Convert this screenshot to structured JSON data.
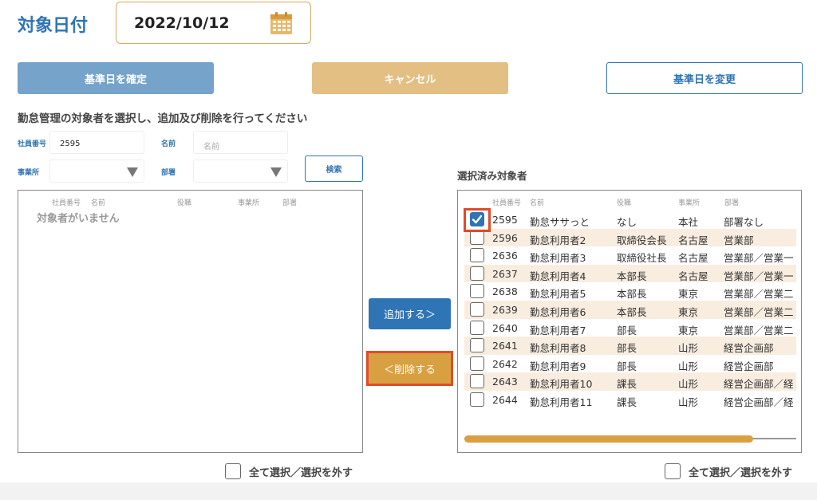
{
  "header": {
    "title": "対象日付",
    "date_value": "2022/10/12",
    "calendar_icon": "calendar-icon"
  },
  "actions": {
    "confirm_label": "基準日を確定",
    "cancel_label": "キャンセル",
    "change_label": "基準日を変更"
  },
  "instruction": "勤怠管理の対象者を選択し、追加及び削除を行ってください",
  "filters": {
    "employee_no_label": "社員番号",
    "employee_no_value": "2595",
    "name_label": "名前",
    "name_placeholder": "名前",
    "office_label": "事業所",
    "office_value": "",
    "dept_label": "部署",
    "dept_value": "",
    "search_label": "検索"
  },
  "left_table": {
    "headers": [
      "社員番号",
      "名前",
      "役職",
      "事業所",
      "部署"
    ],
    "empty_text": "対象者がいません",
    "select_all_label": "全て選択／選択を外す"
  },
  "transfer": {
    "add_label": "追加する＞",
    "remove_label": "＜削除する"
  },
  "right_table": {
    "title": "選択済み対象者",
    "headers": [
      "社員番号",
      "名前",
      "役職",
      "事業所",
      "部署"
    ],
    "rows": [
      {
        "checked": true,
        "no": "2595",
        "name": "勤怠ササっと",
        "role": "なし",
        "office": "本社",
        "dept": "部署なし"
      },
      {
        "checked": false,
        "no": "2596",
        "name": "勤怠利用者2",
        "role": "取締役会長",
        "office": "名古屋",
        "dept": "営業部"
      },
      {
        "checked": false,
        "no": "2636",
        "name": "勤怠利用者3",
        "role": "取締役社長",
        "office": "名古屋",
        "dept": "営業部／営業一"
      },
      {
        "checked": false,
        "no": "2637",
        "name": "勤怠利用者4",
        "role": "本部長",
        "office": "名古屋",
        "dept": "営業部／営業一"
      },
      {
        "checked": false,
        "no": "2638",
        "name": "勤怠利用者5",
        "role": "本部長",
        "office": "東京",
        "dept": "営業部／営業二"
      },
      {
        "checked": false,
        "no": "2639",
        "name": "勤怠利用者6",
        "role": "本部長",
        "office": "東京",
        "dept": "営業部／営業二"
      },
      {
        "checked": false,
        "no": "2640",
        "name": "勤怠利用者7",
        "role": "部長",
        "office": "東京",
        "dept": "営業部／営業二"
      },
      {
        "checked": false,
        "no": "2641",
        "name": "勤怠利用者8",
        "role": "部長",
        "office": "山形",
        "dept": "経営企画部"
      },
      {
        "checked": false,
        "no": "2642",
        "name": "勤怠利用者9",
        "role": "部長",
        "office": "山形",
        "dept": "経営企画部"
      },
      {
        "checked": false,
        "no": "2643",
        "name": "勤怠利用者10",
        "role": "課長",
        "office": "山形",
        "dept": "経営企画部／経"
      },
      {
        "checked": false,
        "no": "2644",
        "name": "勤怠利用者11",
        "role": "課長",
        "office": "山形",
        "dept": "経営企画部／経"
      }
    ],
    "select_all_label": "全て選択／選択を外す"
  },
  "colors": {
    "primary": "#2f74b5",
    "accent": "#d9a042",
    "highlight": "#e04b2b",
    "row_alt": "#f9ede0"
  }
}
